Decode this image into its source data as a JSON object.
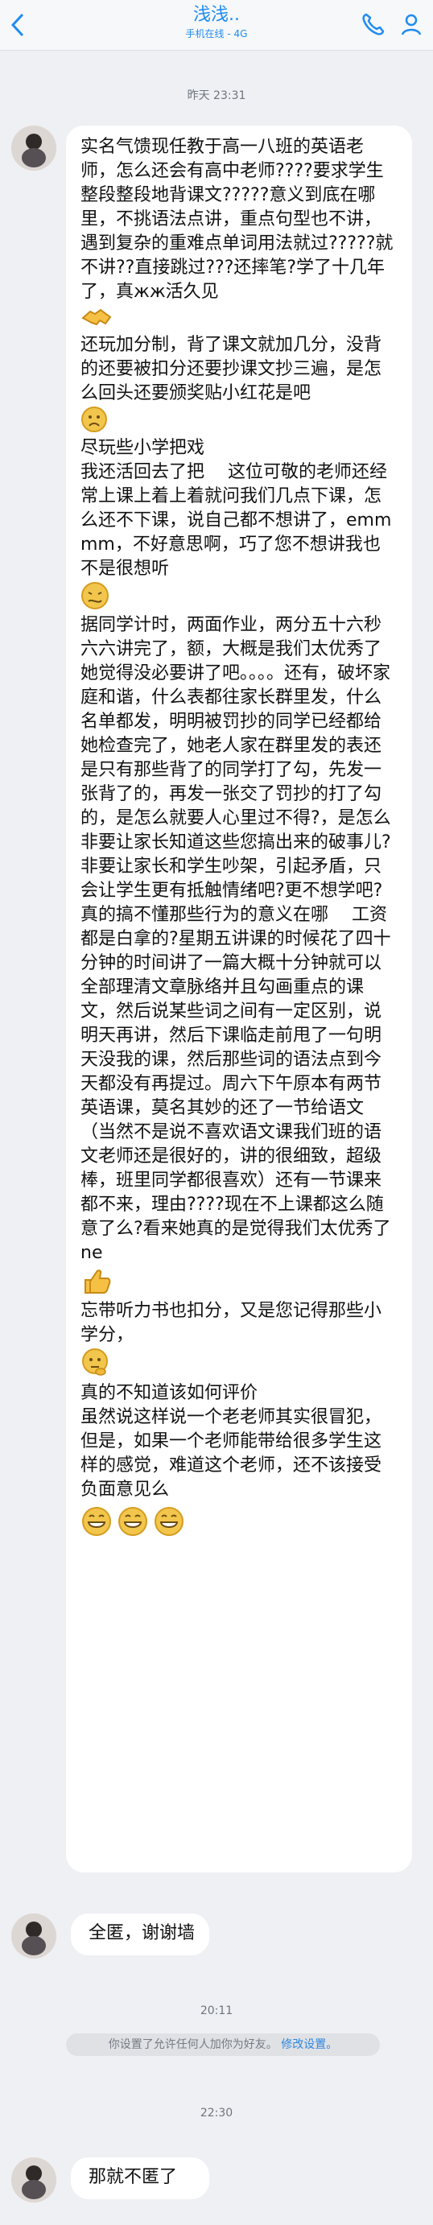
{
  "header": {
    "title": "浅浅..",
    "subtitle": "手机在线 - 4G"
  },
  "chat": {
    "messages": [
      {
        "time": "昨天 23:31",
        "text": "实名气馈现任教于高一八班的英语老师，怎么还会有高中老师????要求学生整段整段地背课文?????意义到底在哪里，不挑语法点讲，重点句型也不讲，遇到复杂的重难点单词用法就过?????就不讲??直接跳过???还摔笔?学了十几年了，真жж活久见",
        "text2": "还玩加分制，背了课文就加几分，没背的还要被扣分还要抄课文抄三遍，是怎么回头还要颁奖贴小红花是吧",
        "text3": "尽玩些小学把戏\n我还活回去了把　 这位可敬的老师还经常上课上着上着就问我们几点下课，怎么还不下课，说自己都不想讲了，emmmm，不好意思啊，巧了您不想讲我也不是很想听",
        "text4": "据同学计时，两面作业，两分五十六秒六六讲完了，额，大概是我们太优秀了她觉得没必要讲了吧。。。。还有，破坏家庭和谐，什么表都往家长群里发，什么名单都发，明明被罚抄的同学已经都给她检查完了，她老人家在群里发的表还是只有那些背了的同学打了勾，先发一张背了的，再发一张交了罚抄的打了勾的，是怎么就要人心里过不得?，是怎么非要让家长知道这些您搞出来的破事儿?非要让家长和学生吵架，引起矛盾，只会让学生更有抵触情绪吧?更不想学吧?真的搞不懂那些行为的意义在哪　 工资都是白拿的?星期五讲课的时候花了四十分钟的时间讲了一篇大概十分钟就可以全部理清文章脉络并且勾画重点的课文，然后说某些词之间有一定区别，说明天再讲，然后下课临走前甩了一句明天没我的课，然后那些词的语法点到今天都没有再提过。周六下午原本有两节英语课，莫名其妙的还了一节给语文（当然不是说不喜欢语文课我们班的语文老师还是很好的，讲的很细致，超级棒，班里同学都很喜欢）还有一节课来都不来，理由????现在不上课都这么随意了么?看来她真的是觉得我们太优秀了ne",
        "text5": "忘带听力书也扣分，又是您记得那些小学分，",
        "text6": "真的不知道该如何评价\n虽然说这样说一个老老师其实很冒犯，但是，如果一个老师能带给很多学生这样的感觉，难道这个老师，还不该接受负面意见么"
      },
      {
        "text": "全匿，谢谢墙"
      },
      {
        "time": "20:11"
      },
      {
        "notice": "你设置了允许任何人加你为好友。",
        "link": "修改设置。"
      },
      {
        "time": "22:30",
        "text": "那就不匿了"
      }
    ]
  }
}
